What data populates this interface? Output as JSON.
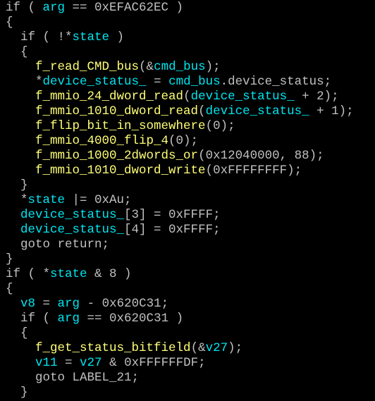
{
  "colors": {
    "background": "#000000",
    "plain": "#c0c0c0",
    "function": "#ffff77",
    "variable": "#00e5f0",
    "number": "#c0c0c0"
  },
  "code": {
    "lines": [
      {
        "indent": "",
        "tokens": [
          {
            "t": "plain",
            "v": "if ( "
          },
          {
            "t": "var",
            "v": "arg"
          },
          {
            "t": "plain",
            "v": " == 0xEFAC62EC )"
          }
        ]
      },
      {
        "indent": "",
        "tokens": [
          {
            "t": "plain",
            "v": "{"
          }
        ]
      },
      {
        "indent": "  ",
        "tokens": [
          {
            "t": "plain",
            "v": "if ( !*"
          },
          {
            "t": "var",
            "v": "state"
          },
          {
            "t": "plain",
            "v": " )"
          }
        ]
      },
      {
        "indent": "  ",
        "tokens": [
          {
            "t": "plain",
            "v": "{"
          }
        ]
      },
      {
        "indent": "    ",
        "tokens": [
          {
            "t": "func",
            "v": "f_read_CMD_bus"
          },
          {
            "t": "plain",
            "v": "(&"
          },
          {
            "t": "var",
            "v": "cmd_bus"
          },
          {
            "t": "plain",
            "v": ");"
          }
        ]
      },
      {
        "indent": "    ",
        "tokens": [
          {
            "t": "plain",
            "v": "*"
          },
          {
            "t": "var",
            "v": "device_status_"
          },
          {
            "t": "plain",
            "v": " = "
          },
          {
            "t": "var",
            "v": "cmd_bus"
          },
          {
            "t": "plain",
            "v": ".device_status;"
          }
        ]
      },
      {
        "indent": "    ",
        "tokens": [
          {
            "t": "func",
            "v": "f_mmio_24_dword_read"
          },
          {
            "t": "plain",
            "v": "("
          },
          {
            "t": "var",
            "v": "device_status_"
          },
          {
            "t": "plain",
            "v": " + 2);"
          }
        ]
      },
      {
        "indent": "    ",
        "tokens": [
          {
            "t": "func",
            "v": "f_mmio_1010_dword_read"
          },
          {
            "t": "plain",
            "v": "("
          },
          {
            "t": "var",
            "v": "device_status_"
          },
          {
            "t": "plain",
            "v": " + 1);"
          }
        ]
      },
      {
        "indent": "    ",
        "tokens": [
          {
            "t": "func",
            "v": "f_flip_bit_in_somewhere"
          },
          {
            "t": "plain",
            "v": "(0);"
          }
        ]
      },
      {
        "indent": "    ",
        "tokens": [
          {
            "t": "func",
            "v": "f_mmio_4000_flip_4"
          },
          {
            "t": "plain",
            "v": "(0);"
          }
        ]
      },
      {
        "indent": "    ",
        "tokens": [
          {
            "t": "func",
            "v": "f_mmio_1000_2dwords_or"
          },
          {
            "t": "plain",
            "v": "(0x12040000, 88);"
          }
        ]
      },
      {
        "indent": "    ",
        "tokens": [
          {
            "t": "func",
            "v": "f_mmio_1010_dword_write"
          },
          {
            "t": "plain",
            "v": "(0xFFFFFFFF);"
          }
        ]
      },
      {
        "indent": "  ",
        "tokens": [
          {
            "t": "plain",
            "v": "}"
          }
        ]
      },
      {
        "indent": "  ",
        "tokens": [
          {
            "t": "plain",
            "v": "*"
          },
          {
            "t": "var",
            "v": "state"
          },
          {
            "t": "plain",
            "v": " |= 0xAu;"
          }
        ]
      },
      {
        "indent": "  ",
        "tokens": [
          {
            "t": "var",
            "v": "device_status_"
          },
          {
            "t": "plain",
            "v": "[3] = 0xFFFF;"
          }
        ]
      },
      {
        "indent": "  ",
        "tokens": [
          {
            "t": "var",
            "v": "device_status_"
          },
          {
            "t": "plain",
            "v": "[4] = 0xFFFF;"
          }
        ]
      },
      {
        "indent": "  ",
        "tokens": [
          {
            "t": "plain",
            "v": "goto return;"
          }
        ]
      },
      {
        "indent": "",
        "tokens": [
          {
            "t": "plain",
            "v": "}"
          }
        ]
      },
      {
        "indent": "",
        "tokens": [
          {
            "t": "plain",
            "v": "if ( *"
          },
          {
            "t": "var",
            "v": "state"
          },
          {
            "t": "plain",
            "v": " & 8 )"
          }
        ]
      },
      {
        "indent": "",
        "tokens": [
          {
            "t": "plain",
            "v": "{"
          }
        ]
      },
      {
        "indent": "  ",
        "tokens": [
          {
            "t": "var",
            "v": "v8"
          },
          {
            "t": "plain",
            "v": " = "
          },
          {
            "t": "var",
            "v": "arg"
          },
          {
            "t": "plain",
            "v": " - 0x620C31;"
          }
        ]
      },
      {
        "indent": "  ",
        "tokens": [
          {
            "t": "plain",
            "v": "if ( "
          },
          {
            "t": "var",
            "v": "arg"
          },
          {
            "t": "plain",
            "v": " == 0x620C31 )"
          }
        ]
      },
      {
        "indent": "  ",
        "tokens": [
          {
            "t": "plain",
            "v": "{"
          }
        ]
      },
      {
        "indent": "    ",
        "tokens": [
          {
            "t": "func",
            "v": "f_get_status_bitfield"
          },
          {
            "t": "plain",
            "v": "(&"
          },
          {
            "t": "var",
            "v": "v27"
          },
          {
            "t": "plain",
            "v": ");"
          }
        ]
      },
      {
        "indent": "    ",
        "tokens": [
          {
            "t": "var",
            "v": "v11"
          },
          {
            "t": "plain",
            "v": " = "
          },
          {
            "t": "var",
            "v": "v27"
          },
          {
            "t": "plain",
            "v": " & 0xFFFFFFDF;"
          }
        ]
      },
      {
        "indent": "    ",
        "tokens": [
          {
            "t": "plain",
            "v": "goto LABEL_21;"
          }
        ]
      },
      {
        "indent": "  ",
        "tokens": [
          {
            "t": "plain",
            "v": "}"
          }
        ]
      }
    ]
  }
}
